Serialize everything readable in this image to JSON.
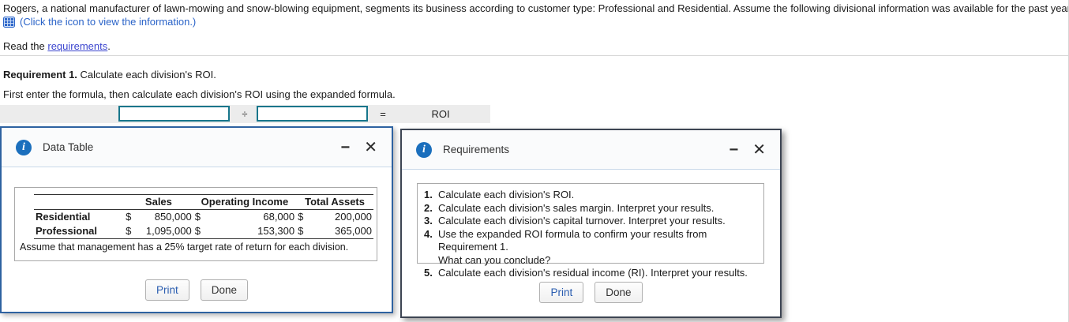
{
  "page": {
    "intro": "Rogers, a national manufacturer of lawn-mowing and snow-blowing equipment, segments its business according to customer type: Professional and Residential. Assume the following divisional information was available for the past year (in thousands of dollars):",
    "icon_caption": "(Click the icon to view the information.)",
    "read_prefix": "Read the ",
    "read_link": "requirements",
    "read_suffix": "."
  },
  "requirement1": {
    "label": "Requirement 1.",
    "text": " Calculate each division's ROI.",
    "instruction": "First enter the formula, then calculate each division's ROI using the expanded formula.",
    "formula": {
      "numerator_value": "",
      "denominator_value": "",
      "divide_sign": "÷",
      "equals_sign": "=",
      "result_label": "ROI"
    }
  },
  "data_table_window": {
    "title": "Data Table",
    "minimize_glyph": "−",
    "close_glyph": "✕",
    "table": {
      "col_headers": [
        "Sales",
        "Operating Income",
        "Total Assets"
      ],
      "rows": [
        {
          "label": "Residential",
          "sales_cur": "$",
          "sales": "850,000",
          "oi_cur": "$",
          "oi": "68,000",
          "ta_cur": "$",
          "ta": "200,000"
        },
        {
          "label": "Professional",
          "sales_cur": "$",
          "sales": "1,095,000",
          "oi_cur": "$",
          "oi": "153,300",
          "ta_cur": "$",
          "ta": "365,000"
        }
      ],
      "note": "Assume that management has a 25% target rate of return for each division."
    },
    "print_label": "Print",
    "done_label": "Done"
  },
  "requirements_window": {
    "title": "Requirements",
    "minimize_glyph": "−",
    "close_glyph": "✕",
    "items": [
      {
        "num": "1.",
        "line1": "Calculate each division's ROI.",
        "line2": ""
      },
      {
        "num": "2.",
        "line1": "Calculate each division's sales margin. Interpret your results.",
        "line2": ""
      },
      {
        "num": "3.",
        "line1": "Calculate each division's capital turnover. Interpret your results.",
        "line2": ""
      },
      {
        "num": "4.",
        "line1": "Use the expanded ROI formula to confirm your results from Requirement 1.",
        "line2": "What can you conclude?"
      },
      {
        "num": "5.",
        "line1": "Calculate each division's residual income (RI). Interpret your results.",
        "line2": ""
      }
    ],
    "print_label": "Print",
    "done_label": "Done"
  },
  "colors": {
    "window_border_blue": "#2e62a1",
    "window_border_dark": "#3d4553",
    "titlebar_bg": "#fafbfc",
    "titlebar_divider": "#c9d9ea",
    "info_icon_blue": "#1b6fbd",
    "formula_bar_bg": "#ececec",
    "input_border_teal": "#17768b",
    "link_blue": "#3c46cf",
    "caption_blue": "#2a63c8",
    "print_text_blue": "#2a5db0"
  }
}
